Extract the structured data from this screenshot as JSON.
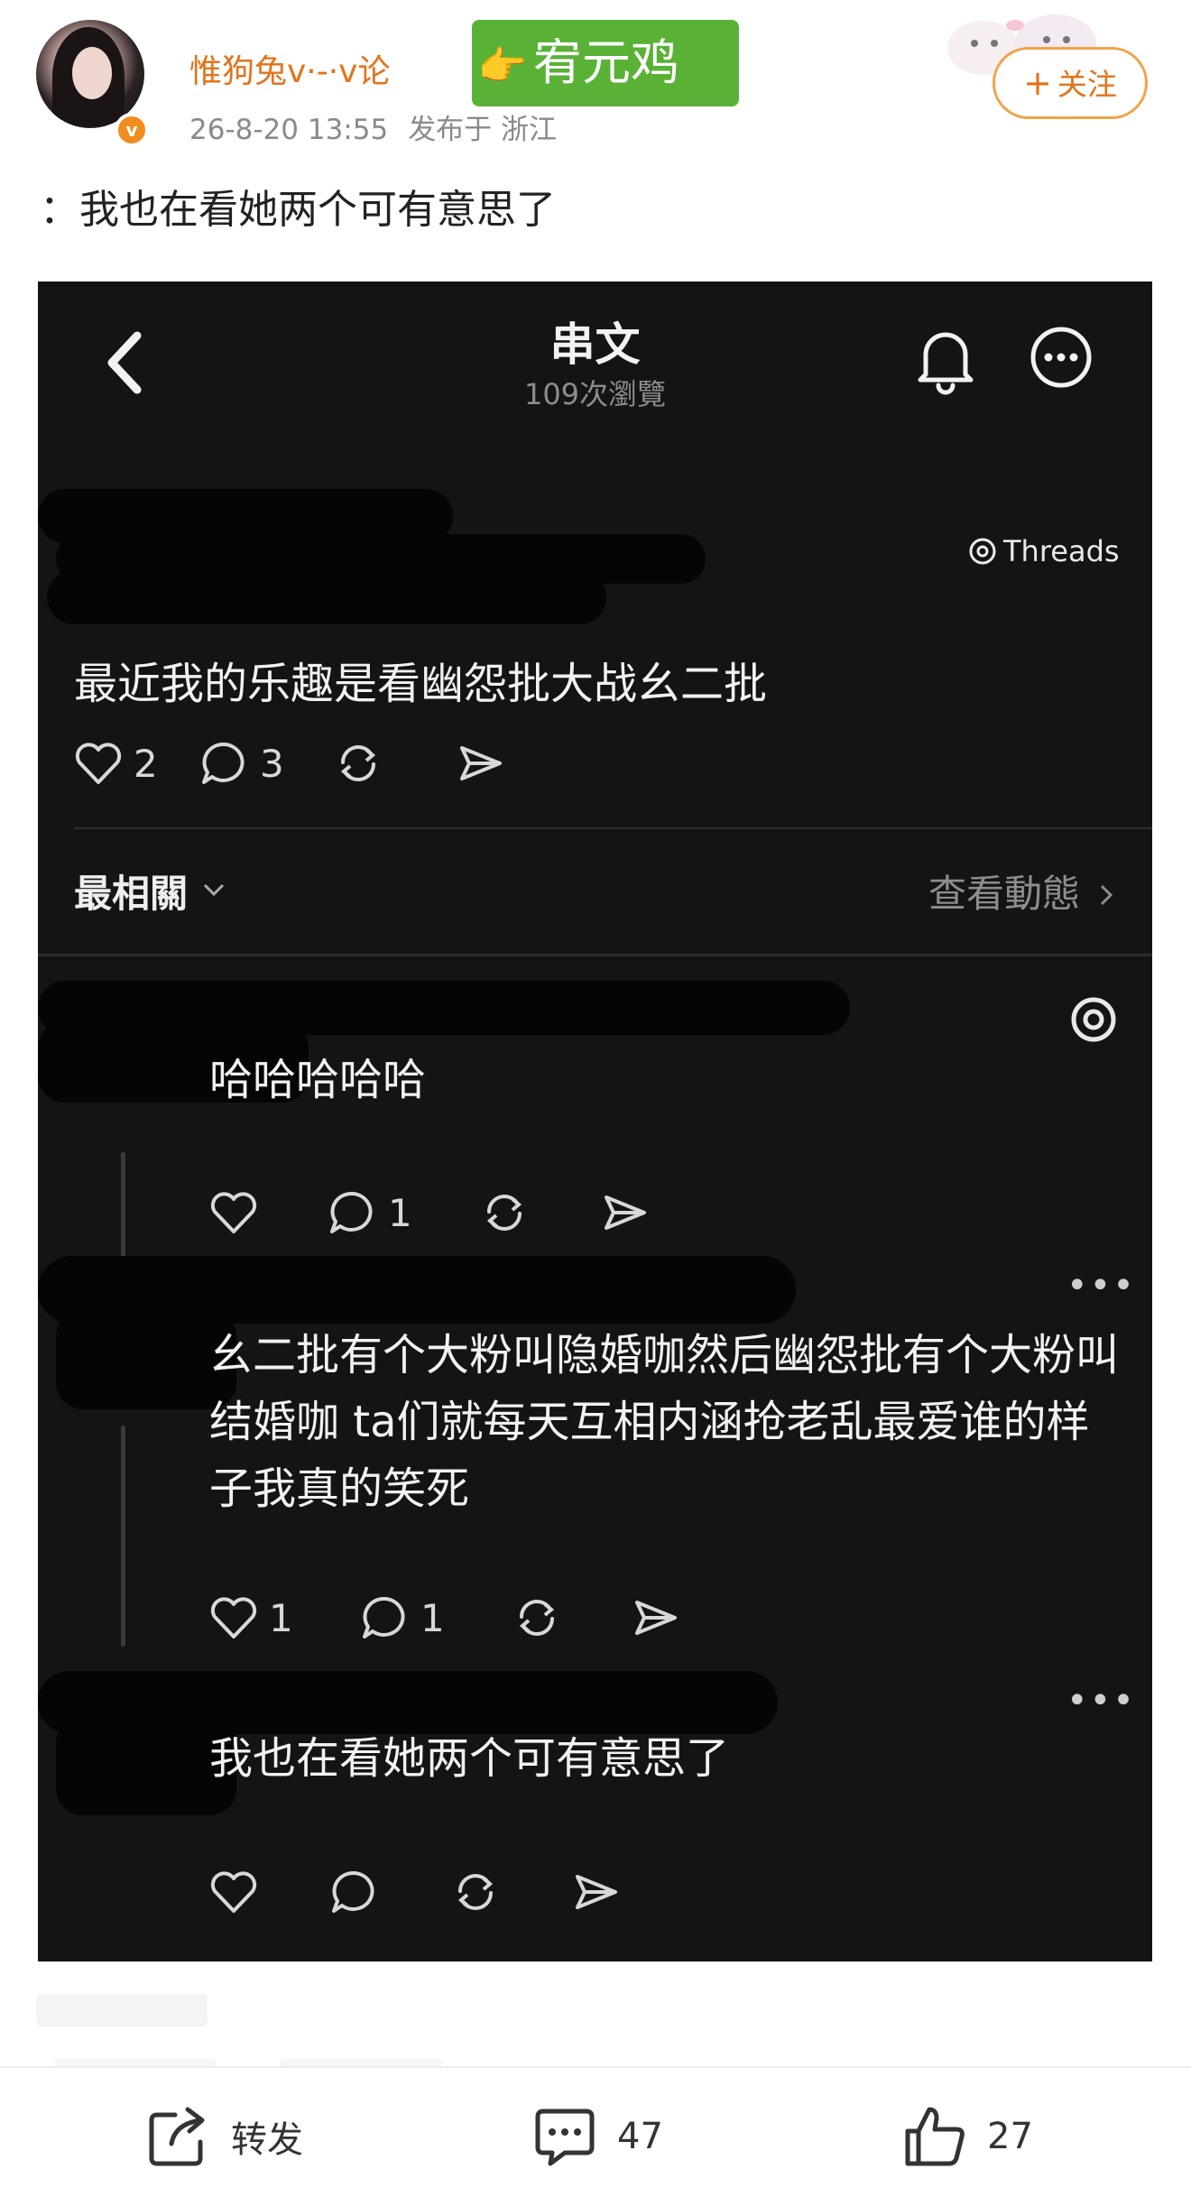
{
  "header": {
    "username": "惟狗兔v·-·v论",
    "badge_text": "宥元鸡",
    "badge_emoji": "👉",
    "date": "26-8-20 13:55",
    "location": "发布于 浙江",
    "follow_label": "关注",
    "follow_plus": "+"
  },
  "post": {
    "text": "：我也在看她两个可有意思了"
  },
  "screenshot": {
    "title": "串文",
    "views": "109次瀏覽",
    "threads_label": "Threads",
    "main_text": "最近我的乐趣是看幽怨批大战幺二批",
    "main_likes": "2",
    "main_comments": "3",
    "sort_label": "最相關",
    "activity_label": "查看動態",
    "replies": [
      {
        "text": "哈哈哈哈哈",
        "likes": "",
        "comments": "1"
      },
      {
        "text": "幺二批有个大粉叫隐婚咖然后幽怨批有个大粉叫结婚咖 ta们就每天互相内涵抢老乱最爱谁的样子我真的笑死",
        "likes": "1",
        "comments": "1"
      },
      {
        "text": "我也在看她两个可有意思了",
        "likes": "",
        "comments": ""
      }
    ]
  },
  "bottom_bar": {
    "repost_label": "转发",
    "comment_count": "47",
    "like_count": "27"
  },
  "colors": {
    "accent": "#e3731b",
    "badge_green": "#59b236",
    "dark_bg": "#141414"
  }
}
